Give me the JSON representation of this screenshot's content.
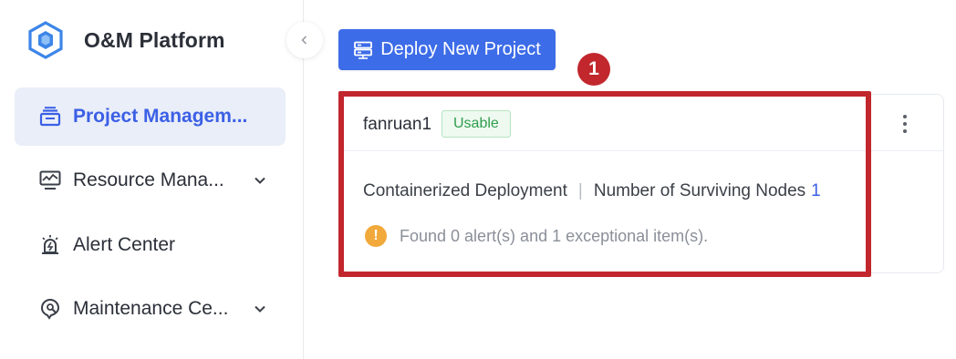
{
  "app": {
    "title": "O&M Platform"
  },
  "sidebar": {
    "items": [
      {
        "label": "Project Managem...",
        "icon": "project-icon",
        "active": true,
        "has_submenu": false
      },
      {
        "label": "Resource Mana...",
        "icon": "monitor-chart-icon",
        "active": false,
        "has_submenu": true
      },
      {
        "label": "Alert Center",
        "icon": "alarm-icon",
        "active": false,
        "has_submenu": false
      },
      {
        "label": "Maintenance Ce...",
        "icon": "maintenance-icon",
        "active": false,
        "has_submenu": true
      }
    ]
  },
  "toolbar": {
    "deploy_label": "Deploy New Project"
  },
  "annotation": {
    "step": "1"
  },
  "project_card": {
    "name": "fanruan1",
    "status": "Usable",
    "deployment_type": "Containerized Deployment",
    "separator": "|",
    "nodes_label": "Number of Surviving Nodes",
    "nodes_count": "1",
    "alert_text": "Found 0 alert(s) and 1 exceptional item(s).",
    "warn_glyph": "!"
  },
  "colors": {
    "primary": "#3d6ce8",
    "active_bg": "#e9eef8",
    "status_green": "#2e9d4d",
    "highlight_red": "#c1272d",
    "warning": "#f2a93b"
  }
}
